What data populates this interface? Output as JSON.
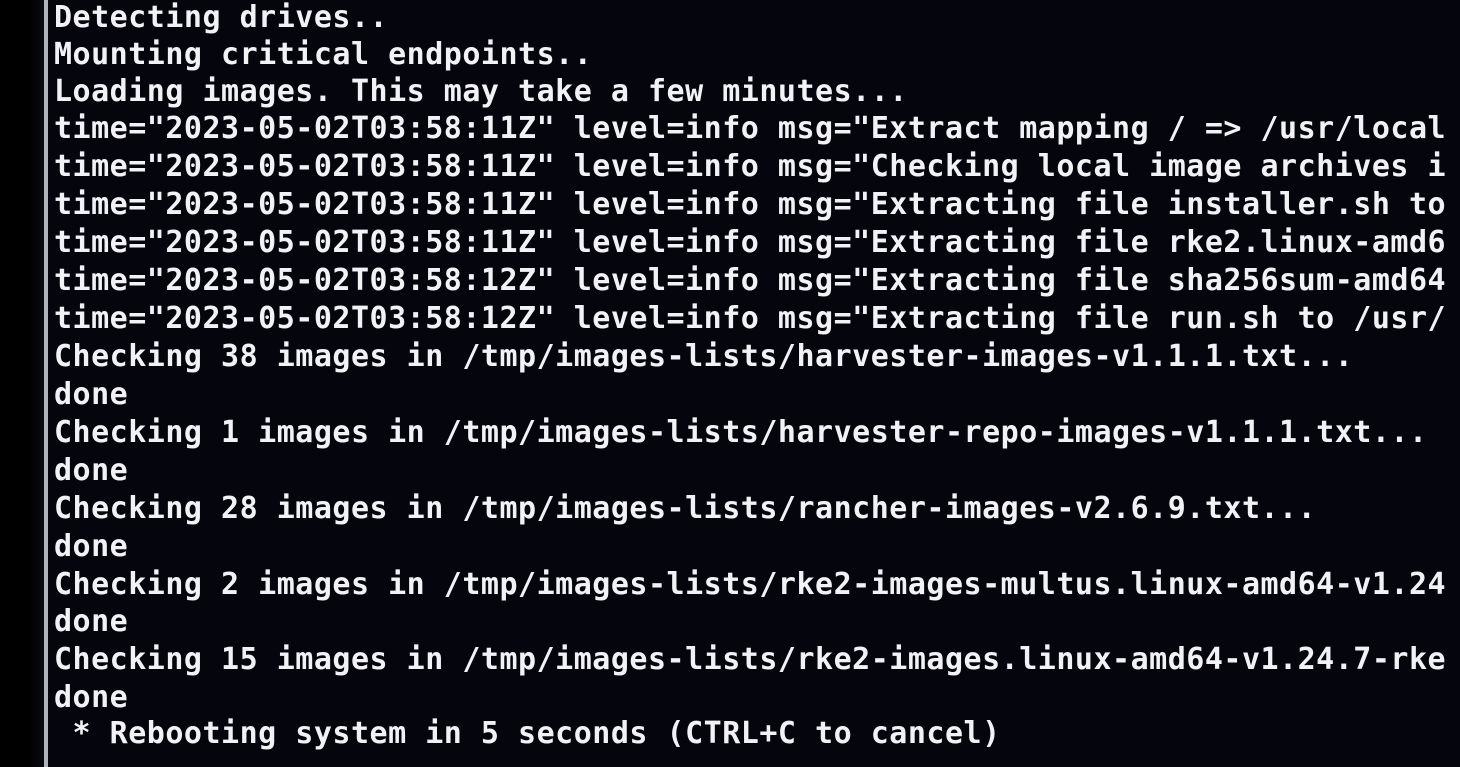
{
  "terminal": {
    "lines": [
      "Detecting drives..",
      "Mounting critical endpoints..",
      "Loading images. This may take a few minutes...",
      "time=\"2023-05-02T03:58:11Z\" level=info msg=\"Extract mapping / => /usr/local",
      "time=\"2023-05-02T03:58:11Z\" level=info msg=\"Checking local image archives i",
      "time=\"2023-05-02T03:58:11Z\" level=info msg=\"Extracting file installer.sh to",
      "time=\"2023-05-02T03:58:11Z\" level=info msg=\"Extracting file rke2.linux-amd6",
      "time=\"2023-05-02T03:58:12Z\" level=info msg=\"Extracting file sha256sum-amd64",
      "time=\"2023-05-02T03:58:12Z\" level=info msg=\"Extracting file run.sh to /usr/",
      "Checking 38 images in /tmp/images-lists/harvester-images-v1.1.1.txt...",
      "done",
      "Checking 1 images in /tmp/images-lists/harvester-repo-images-v1.1.1.txt...",
      "done",
      "Checking 28 images in /tmp/images-lists/rancher-images-v2.6.9.txt...",
      "done",
      "Checking 2 images in /tmp/images-lists/rke2-images-multus.linux-amd64-v1.24",
      "done",
      "Checking 15 images in /tmp/images-lists/rke2-images.linux-amd64-v1.24.7-rke",
      "done",
      " * Rebooting system in 5 seconds (CTRL+C to cancel)"
    ]
  },
  "colors": {
    "background": "#05050d",
    "text": "#f2f2f6"
  }
}
